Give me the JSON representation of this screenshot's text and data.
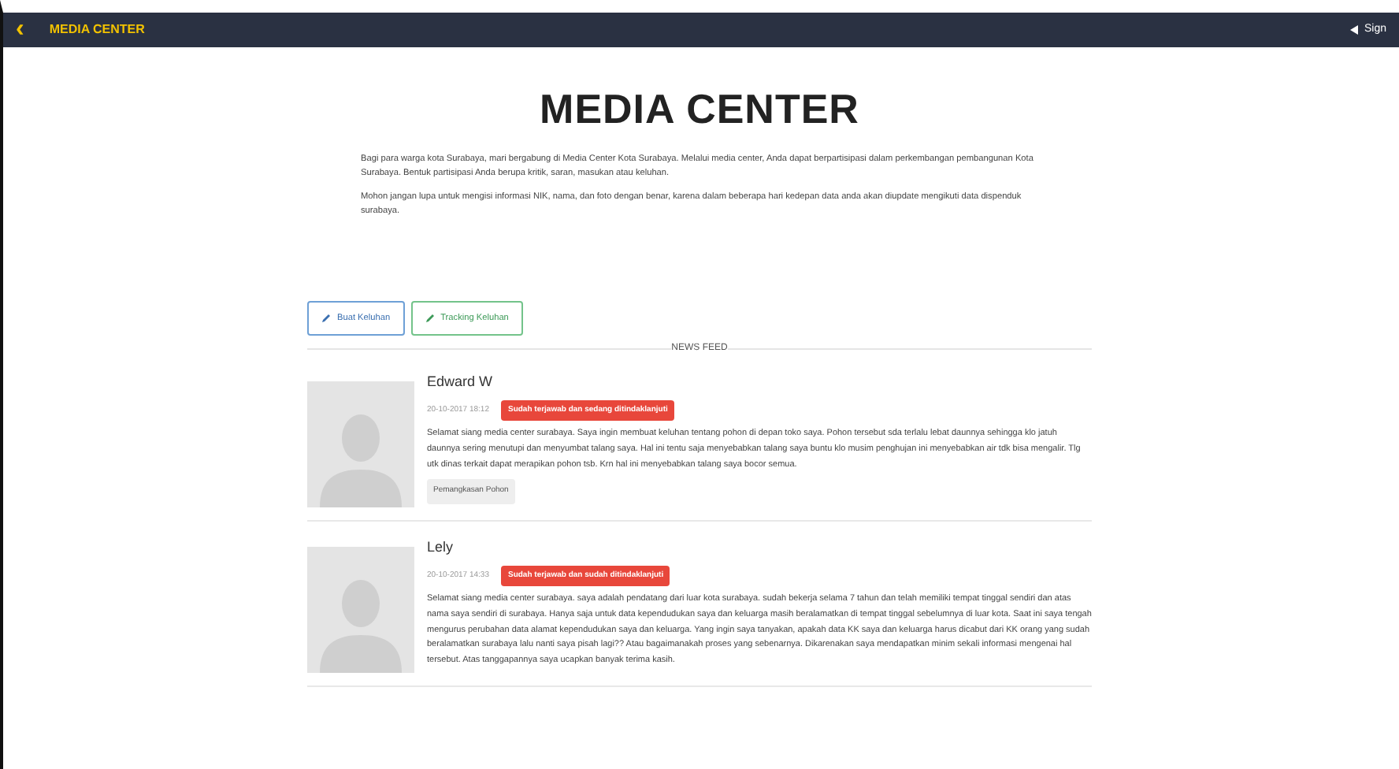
{
  "navbar": {
    "back_icon": "‹",
    "title": "MEDIA CENTER",
    "sign_in": "Sign"
  },
  "heading": "MEDIA CENTER",
  "intro": [
    "Bagi para warga kota Surabaya, mari bergabung di Media Center Kota Surabaya. Melalui media center, Anda dapat berpartisipasi dalam perkembangan pembangunan Kota Surabaya. Bentuk partisipasi Anda berupa kritik, saran, masukan atau keluhan.",
    "Mohon jangan lupa untuk mengisi informasi NIK, nama, dan foto dengan benar, karena dalam beberapa hari kedepan data anda akan diupdate mengikuti data dispenduk surabaya."
  ],
  "buttons": [
    {
      "label": "Buat Keluhan",
      "kind": "primary"
    },
    {
      "label": "Tracking Keluhan",
      "kind": "success"
    }
  ],
  "news_feed_label": "NEWS FEED",
  "posts": [
    {
      "name": "Edward W",
      "date": "20-10-2017 18:12",
      "status": "Sudah terjawab dan sedang ditindaklanjuti",
      "text": "Selamat siang media center surabaya. Saya ingin membuat keluhan tentang pohon di depan toko saya. Pohon tersebut sda terlalu lebat daunnya sehingga klo jatuh daunnya sering menutupi dan menyumbat talang saya. Hal ini tentu saja menyebabkan talang saya buntu klo musim penghujan ini menyebabkan air tdk bisa mengalir. Tlg utk dinas terkait dapat merapikan pohon tsb. Krn hal ini menyebabkan talang saya bocor semua.",
      "tag": "Pemangkasan Pohon"
    },
    {
      "name": "Lely",
      "date": "20-10-2017 14:33",
      "status": "Sudah terjawab dan sudah ditindaklanjuti",
      "text": "Selamat siang media center surabaya. saya adalah pendatang dari luar kota surabaya. sudah bekerja selama 7 tahun dan telah memiliki tempat tinggal sendiri dan atas nama saya sendiri di surabaya. Hanya saja untuk data kependudukan saya dan keluarga masih beralamatkan di tempat tinggal sebelumnya di luar kota. Saat ini saya tengah mengurus perubahan data alamat kependudukan saya dan keluarga. Yang ingin saya tanyakan, apakah data KK saya dan keluarga harus dicabut dari KK orang yang sudah beralamatkan surabaya lalu nanti saya pisah lagi?? Atau bagaimanakah proses yang sebenarnya. Dikarenakan saya mendapatkan minim sekali informasi mengenai hal tersebut. Atas tanggapannya saya ucapkan banyak terima kasih."
    }
  ]
}
